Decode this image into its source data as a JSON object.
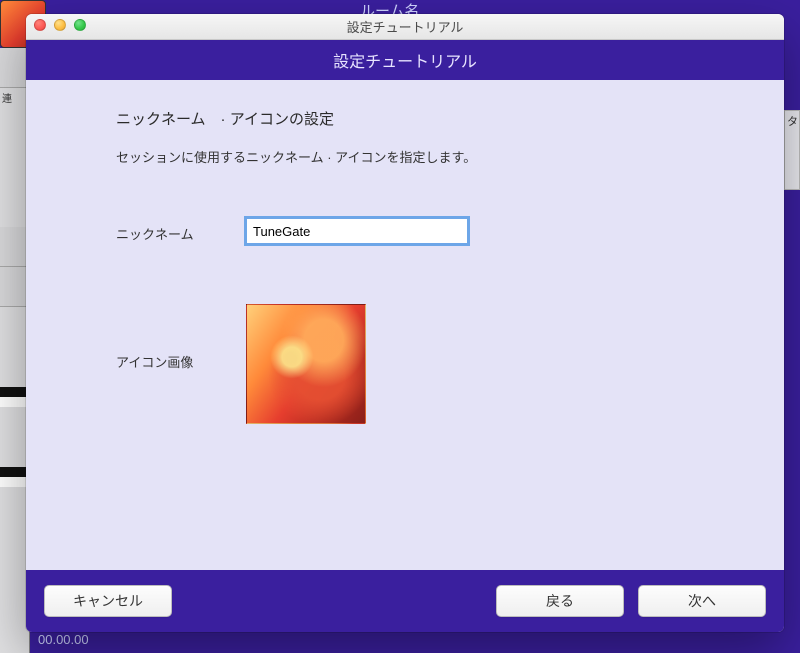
{
  "background": {
    "room_label": "ルーム名",
    "sidebar_label": "連",
    "right_label": "タ",
    "timer": "00.00.00"
  },
  "window": {
    "title": "設定チュートリアル",
    "header": "設定チュートリアル"
  },
  "section": {
    "heading": "ニックネーム　· アイコンの設定",
    "description": "セッションに使用するニックネーム · アイコンを指定します。"
  },
  "form": {
    "nickname_label": "ニックネーム",
    "nickname_value": "TuneGate",
    "icon_label": "アイコン画像",
    "icon_name": "singer-thumbnail"
  },
  "buttons": {
    "cancel": "キャンセル",
    "back": "戻る",
    "next": "次へ"
  }
}
